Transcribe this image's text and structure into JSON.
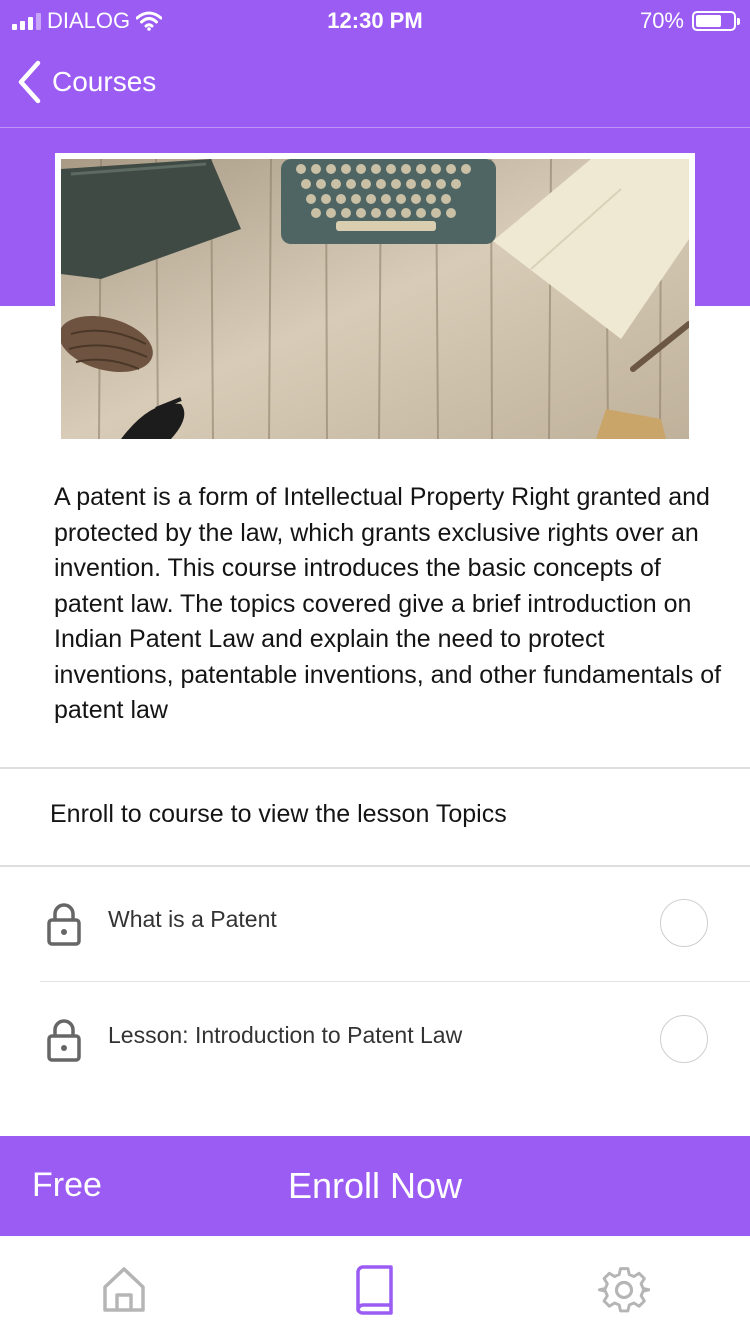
{
  "status_bar": {
    "carrier": "DIALOG",
    "time": "12:30 PM",
    "battery_percent": "70%",
    "battery_level": 0.7
  },
  "nav": {
    "back_label": "Courses",
    "back_icon": "chevron-left-icon"
  },
  "course": {
    "description": "A patent is a form of Intellectual Property Right granted and protected by the law, which grants exclusive rights over an invention. This course introduces the basic concepts of patent law. The topics covered give a brief introduction on Indian Patent Law and explain the need to protect inventions, patentable inventions, and other fundamentals of patent law",
    "lessons_hint": "Enroll to course to view the lesson Topics",
    "lessons": [
      {
        "title": "What is a Patent",
        "icon": "lock-icon",
        "completed": false
      },
      {
        "title": "Lesson: Introduction to Patent Law",
        "icon": "lock-icon",
        "completed": false
      }
    ]
  },
  "enroll_bar": {
    "price": "Free",
    "enroll_label": "Enroll Now"
  },
  "tab_bar": {
    "tabs": [
      {
        "icon": "home-icon",
        "active": false
      },
      {
        "icon": "book-icon",
        "active": true
      },
      {
        "icon": "gear-icon",
        "active": false
      }
    ]
  },
  "colors": {
    "accent": "#9b5cf3",
    "inactive_icon": "#b5b5b5"
  }
}
